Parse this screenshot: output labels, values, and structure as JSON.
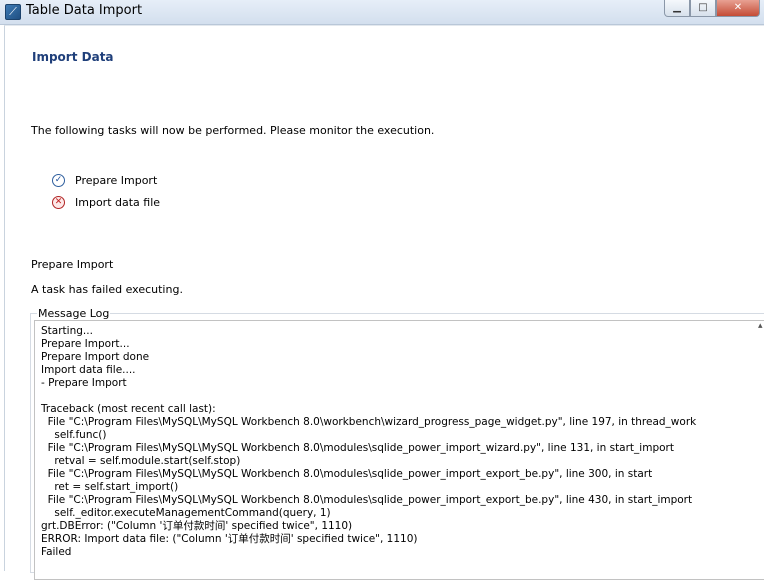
{
  "window": {
    "title": "Table Data Import",
    "icon": "mysql-workbench-icon",
    "buttons": {
      "minimize": "minimize-icon",
      "maximize": "maximize-icon",
      "close": "close-icon"
    }
  },
  "page": {
    "heading": "Import Data",
    "intro": "The following tasks will now be performed. Please monitor the execution."
  },
  "tasks": [
    {
      "label": "Prepare Import",
      "status": "done",
      "icon": "checkmark-icon"
    },
    {
      "label": "Import data file",
      "status": "failed",
      "icon": "error-icon"
    }
  ],
  "current_task": {
    "title": "Prepare Import",
    "status_text": "A task has failed executing."
  },
  "message_log": {
    "label": "Message Log",
    "lines": [
      "Starting...",
      "Prepare Import...",
      "Prepare Import done",
      "Import data file....",
      "- Prepare Import",
      "",
      "Traceback (most recent call last):",
      "  File \"C:\\Program Files\\MySQL\\MySQL Workbench 8.0\\workbench\\wizard_progress_page_widget.py\", line 197, in thread_work",
      "    self.func()",
      "  File \"C:\\Program Files\\MySQL\\MySQL Workbench 8.0\\modules\\sqlide_power_import_wizard.py\", line 131, in start_import",
      "    retval = self.module.start(self.stop)",
      "  File \"C:\\Program Files\\MySQL\\MySQL Workbench 8.0\\modules\\sqlide_power_import_export_be.py\", line 300, in start",
      "    ret = self.start_import()",
      "  File \"C:\\Program Files\\MySQL\\MySQL Workbench 8.0\\modules\\sqlide_power_import_export_be.py\", line 430, in start_import",
      "    self._editor.executeManagementCommand(query, 1)",
      "grt.DBError: (\"Column '订单付款时间' specified twice\", 1110)",
      "ERROR: Import data file: (\"Column '订单付款时间' specified twice\", 1110)",
      "Failed"
    ]
  },
  "colors": {
    "heading": "#1f3f7a",
    "titlebar": "#d3dfee",
    "done": "#1f4f9a",
    "failed": "#c01e1e"
  }
}
